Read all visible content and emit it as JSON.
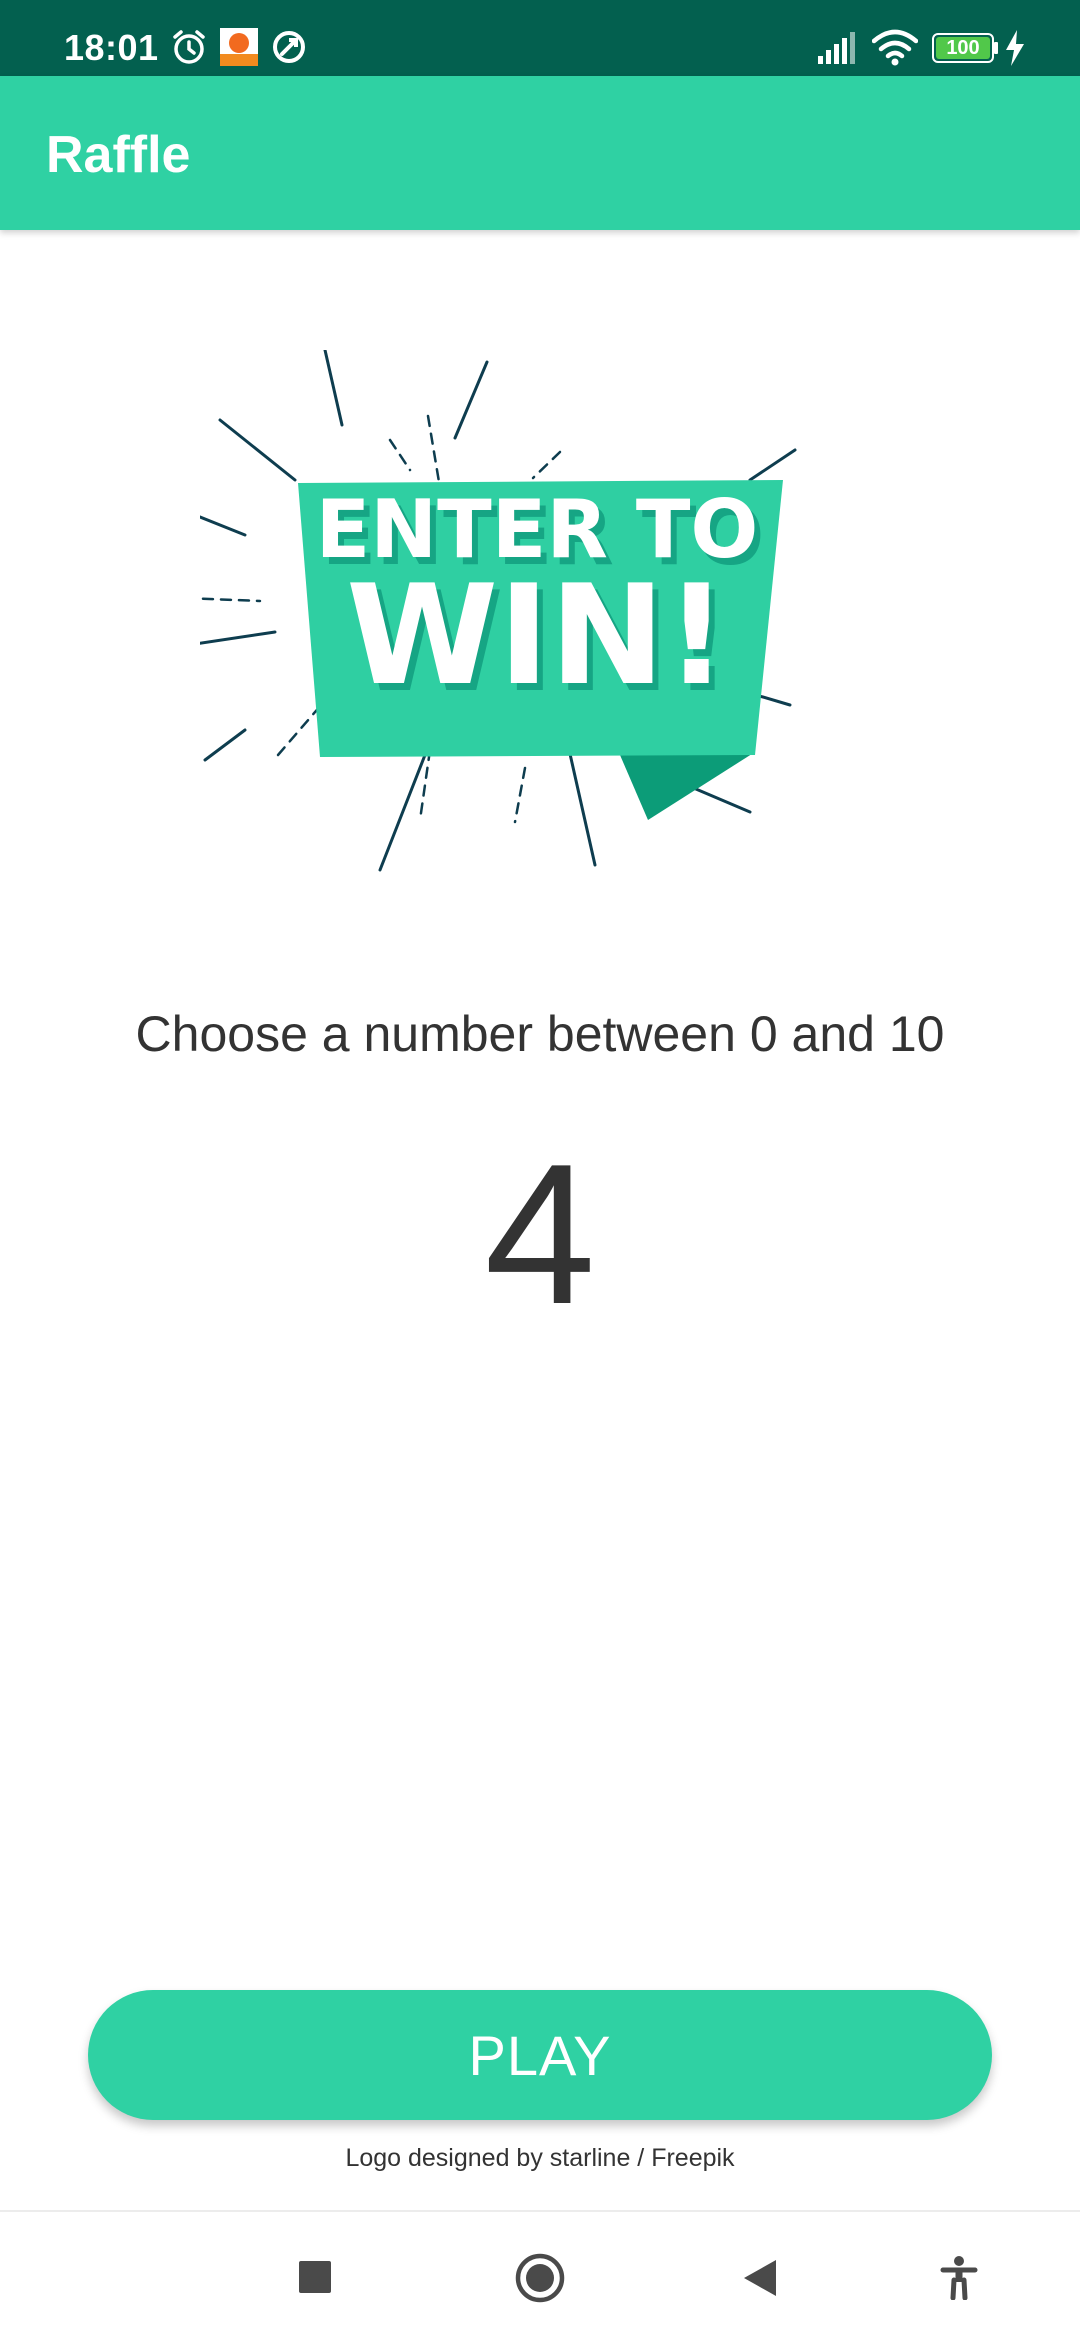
{
  "status_bar": {
    "time": "18:01",
    "battery": "100",
    "icons": [
      "alarm-icon",
      "app-notification-icon",
      "sync-icon",
      "signal-icon",
      "wifi-icon",
      "battery-icon",
      "charging-icon"
    ]
  },
  "app_bar": {
    "title": "Raffle"
  },
  "logo": {
    "line1": "ENTER TO",
    "line2": "WIN!"
  },
  "main": {
    "prompt": "Choose a number between 0 and 10",
    "selected_number": "4"
  },
  "play_button": {
    "label": "PLAY"
  },
  "credit": "Logo designed by starline / Freepik",
  "nav_bar": {
    "icons": [
      "recents-icon",
      "home-icon",
      "back-icon",
      "accessibility-icon"
    ]
  },
  "colors": {
    "primary": "#2fd1a3",
    "primary_dark": "#03604f",
    "text": "#333333"
  }
}
